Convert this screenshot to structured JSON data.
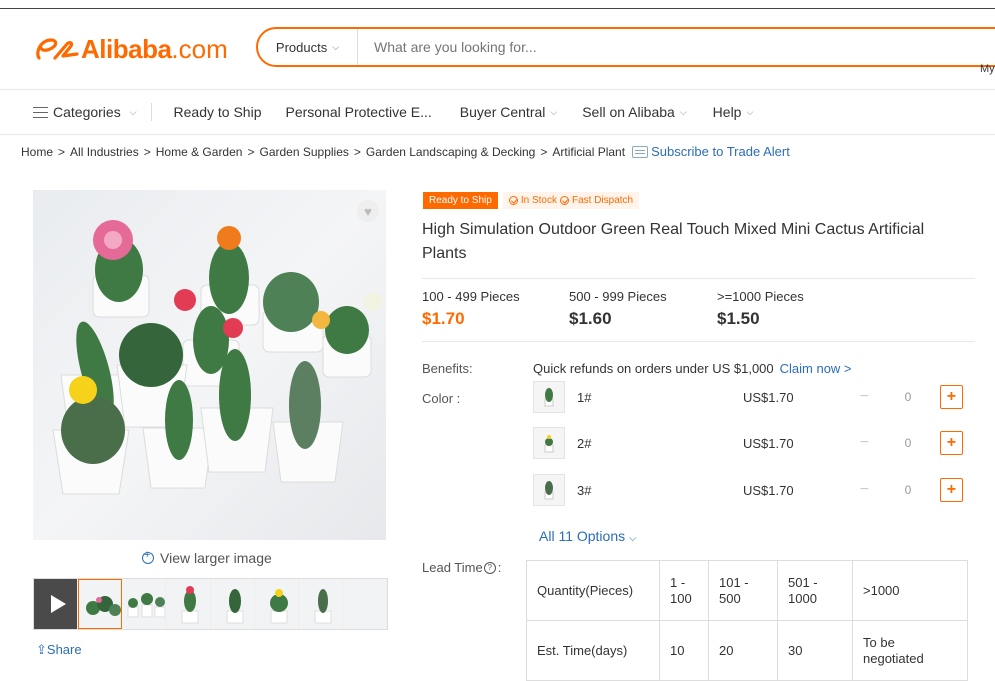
{
  "header": {
    "logo_text": "Alibaba",
    "logo_suffix": ".com",
    "search": {
      "category_label": "Products",
      "placeholder": "What are you looking for..."
    },
    "my_link": "My"
  },
  "nav": {
    "categories_label": "Categories",
    "items": [
      {
        "label": "Ready to Ship"
      },
      {
        "label": "Personal Protective E..."
      },
      {
        "label": "Buyer Central"
      },
      {
        "label": "Sell on Alibaba"
      },
      {
        "label": "Help"
      }
    ]
  },
  "breadcrumb": {
    "items": [
      "Home",
      "All Industries",
      "Home & Garden",
      "Garden Supplies",
      "Garden Landscaping & Decking",
      "Artificial Plant"
    ],
    "separator": ">",
    "subscribe_label": "Subscribe to Trade Alert"
  },
  "gallery": {
    "view_larger_label": "View larger image",
    "share_label": "Share"
  },
  "product": {
    "badge_ready": "Ready to Ship",
    "badge_stock": "In Stock",
    "badge_dispatch": "Fast Dispatch",
    "title": "High Simulation Outdoor Green Real Touch Mixed Mini Cactus Artificial Plants",
    "price_tiers": [
      {
        "range": "100 - 499 Pieces",
        "price": "$1.70"
      },
      {
        "range": "500 - 999 Pieces",
        "price": "$1.60"
      },
      {
        "range": ">=1000 Pieces",
        "price": "$1.50"
      }
    ],
    "benefits_label": "Benefits:",
    "benefits_text": "Quick refunds on orders under US $1,000",
    "claim_label": "Claim now >",
    "color_label": "Color :",
    "options": [
      {
        "name": "1#",
        "price": "US$1.70",
        "qty": "0"
      },
      {
        "name": "2#",
        "price": "US$1.70",
        "qty": "0"
      },
      {
        "name": "3#",
        "price": "US$1.70",
        "qty": "0"
      }
    ],
    "all_options_label": "All 11 Options",
    "lead_time_label": "Lead Time",
    "lead_time_table": {
      "row1": [
        "Quantity(Pieces)",
        "1 - 100",
        "101 - 500",
        "501 - 1000",
        ">1000"
      ],
      "row2": [
        "Est. Time(days)",
        "10",
        "20",
        "30",
        "To be negotiated"
      ]
    }
  },
  "colors": {
    "accent": "#ff6a00",
    "link": "#2c6db8"
  }
}
